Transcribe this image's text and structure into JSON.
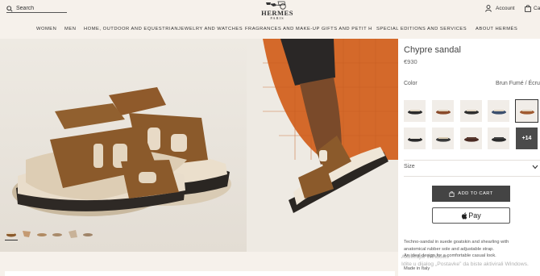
{
  "header": {
    "search_placeholder": "Search",
    "logo_brand": "HERMES",
    "logo_city": "PARIS",
    "account_label": "Account",
    "cart_label": "Ca"
  },
  "nav": {
    "items": [
      "WOMEN",
      "MEN",
      "HOME, OUTDOOR AND EQUESTRIAN",
      "JEWELRY AND WATCHES",
      "FRAGRANCES AND MAKE-UP",
      "GIFTS AND PETIT H",
      "SPECIAL EDITIONS AND SERVICES",
      "ABOUT HERMÈS"
    ]
  },
  "product": {
    "title": "Chypre sandal",
    "price": "€930",
    "color_label": "Color",
    "color_value": "Brun Fumé / Écru",
    "more_swatches": "+14",
    "size_label": "Size",
    "add_to_cart": "ADD TO CART",
    "pay_label": "Pay",
    "description_lines": [
      "Techno-sandal in suede goatskin and shearling with",
      "anatomical rubber sole and adjustable strap.",
      "An ideal design for a comfortable casual look."
    ],
    "made_in": "Made in Italy",
    "swatch_colors": [
      "#2b2b2b",
      "#8a4a2a",
      "#2e2e2e",
      "#3b4f6e",
      "#a05a30",
      "#2a2a2a",
      "#3a3a3a",
      "#4a2a22",
      "#2b2b2b"
    ]
  },
  "watermark": {
    "line1": "Aktivirajte Windows",
    "line2": "Idite u dijalog „Postavke” da biste aktivirali Windows."
  },
  "colors": {
    "accent_dark": "#444444",
    "page_bg": "#f6f1eb",
    "suede": "#8b5a2b",
    "shearling": "#e6d8c3",
    "orange_bg": "#d4692a"
  }
}
